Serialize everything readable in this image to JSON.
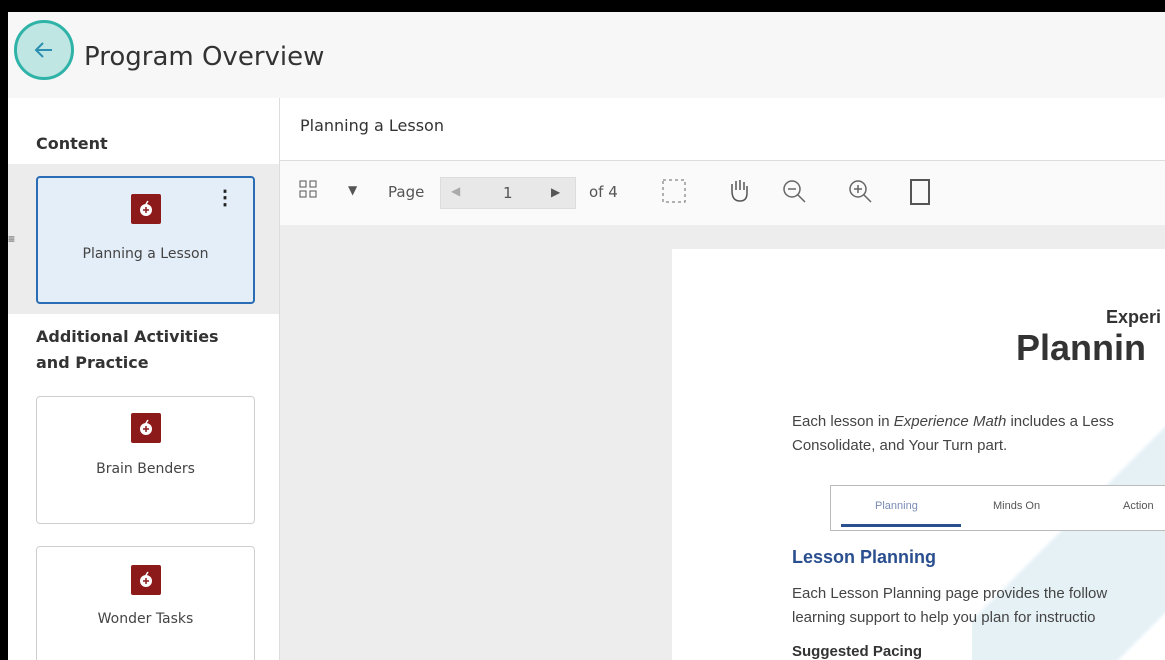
{
  "header": {
    "title": "Program Overview",
    "back_icon": "arrow-left-icon"
  },
  "sidebar": {
    "content_title": "Content",
    "additional_title": "Additional Activities and Practice",
    "content_items": [
      {
        "label": "Planning a Lesson",
        "selected": true
      }
    ],
    "additional_items": [
      {
        "label": "Brain Benders"
      },
      {
        "label": "Wonder Tasks"
      }
    ]
  },
  "main": {
    "doc_title": "Planning a Lesson",
    "toolbar": {
      "page_label": "Page",
      "page_value": "1",
      "page_total": "of 4"
    },
    "document": {
      "heading_small": "Experi",
      "heading_large": "Plannin",
      "intro_line1_prefix": "Each lesson in ",
      "intro_line1_em": "Experience Math",
      "intro_line1_suffix": " includes a Less",
      "intro_line2": "Consolidate, and Your Turn part.",
      "tabs": [
        "Planning",
        "Minds On",
        "Action"
      ],
      "section_heading": "Lesson Planning",
      "section_text1": "Each Lesson Planning page provides the follow",
      "section_text2": "learning support to help you plan for instructio",
      "subheading": "Suggested Pacing"
    }
  },
  "colors": {
    "accent": "#2fb3a8",
    "selected_border": "#2a6db5",
    "icon_bg": "#8c1a1a",
    "doc_heading": "#2a4f8f"
  }
}
